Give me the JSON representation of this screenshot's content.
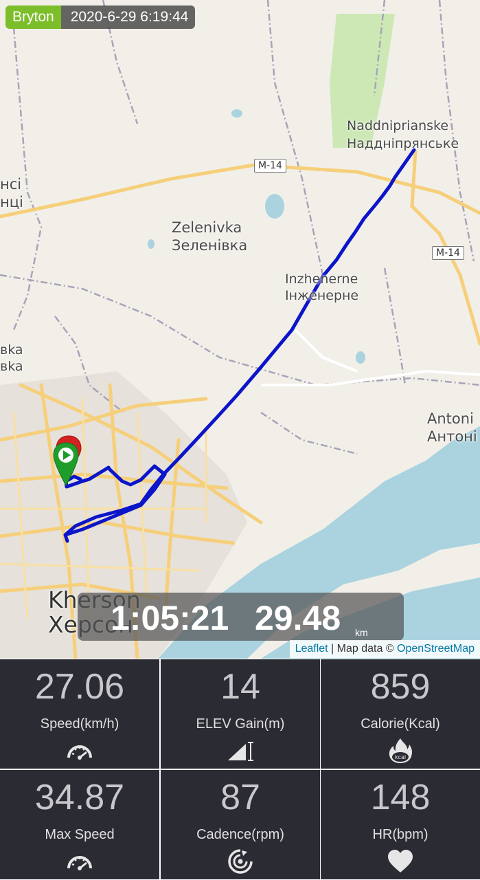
{
  "header": {
    "brand": "Bryton",
    "timestamp": "2020-6-29 6:19:44"
  },
  "map": {
    "places": [
      {
        "latin": "Naddniprianske",
        "cyrillic": "Наддніпрянське"
      },
      {
        "latin": "Zelenivka",
        "cyrillic": "Зеленівка"
      },
      {
        "latin": "Inzhenerne",
        "cyrillic": "Інженерне"
      },
      {
        "latin": "Antoni",
        "cyrillic": "Антоні"
      },
      {
        "latin": "Kherson",
        "cyrillic": "Херсон"
      },
      {
        "latin": "нсі",
        "cyrillic": "нці"
      },
      {
        "latin": "вka",
        "cyrillic": "вka"
      }
    ],
    "road_labels": [
      "M-14",
      "M-14"
    ],
    "attribution": {
      "leaflet": "Leaflet",
      "separator": " | Map data © ",
      "osm": "OpenStreetMap"
    },
    "colors": {
      "route": "#0b15c9",
      "water": "#aad3df",
      "road": "#f6cf7a",
      "background": "#f2efe9",
      "start_marker": "#1f9d2a",
      "end_marker": "#d32222"
    }
  },
  "summary": {
    "elapsed": "1:05:21",
    "distance": "29.48",
    "distance_unit": "km"
  },
  "stats": [
    {
      "value": "27.06",
      "label": "Speed(km/h)",
      "icon": "speedometer-icon"
    },
    {
      "value": "14",
      "label": "ELEV Gain(m)",
      "icon": "elevation-icon"
    },
    {
      "value": "859",
      "label": "Calorie(Kcal)",
      "icon": "flame-kcal-icon"
    },
    {
      "value": "34.87",
      "label": "Max Speed",
      "icon": "speedometer-icon"
    },
    {
      "value": "87",
      "label": "Cadence(rpm)",
      "icon": "cadence-icon"
    },
    {
      "value": "148",
      "label": "HR(bpm)",
      "icon": "heart-icon"
    }
  ]
}
